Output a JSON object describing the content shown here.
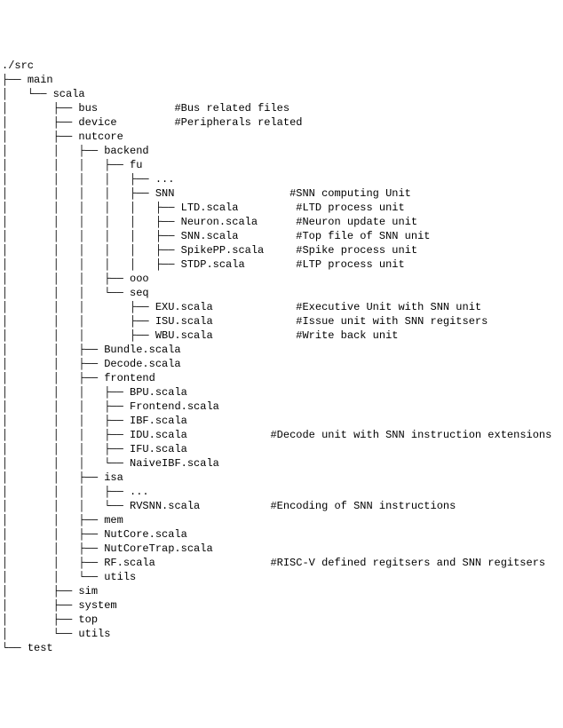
{
  "lines": [
    {
      "prefix": "./",
      "name": "src",
      "comment": ""
    },
    {
      "prefix": "├── ",
      "name": "main",
      "comment": ""
    },
    {
      "prefix": "│   └── ",
      "name": "scala",
      "comment": ""
    },
    {
      "prefix": "│       ├── ",
      "name": "bus",
      "pad": "            ",
      "comment": "#Bus related files"
    },
    {
      "prefix": "│       ├── ",
      "name": "device",
      "pad": "         ",
      "comment": "#Peripherals related"
    },
    {
      "prefix": "│       ├── ",
      "name": "nutcore",
      "comment": ""
    },
    {
      "prefix": "│       │   ├── ",
      "name": "backend",
      "comment": ""
    },
    {
      "prefix": "│       │   │   ├── ",
      "name": "fu",
      "comment": ""
    },
    {
      "prefix": "│       │   │   │   ├── ",
      "name": "...",
      "comment": ""
    },
    {
      "prefix": "│       │   │   │   ├── ",
      "name": "SNN",
      "pad": "                  ",
      "comment": "#SNN computing Unit"
    },
    {
      "prefix": "│       │   │   │   │   ├── ",
      "name": "LTD.scala",
      "pad": "         ",
      "comment": "#LTD process unit"
    },
    {
      "prefix": "│       │   │   │   │   ├── ",
      "name": "Neuron.scala",
      "pad": "      ",
      "comment": "#Neuron update unit"
    },
    {
      "prefix": "│       │   │   │   │   ├── ",
      "name": "SNN.scala",
      "pad": "         ",
      "comment": "#Top file of SNN unit"
    },
    {
      "prefix": "│       │   │   │   │   ├── ",
      "name": "SpikePP.scala",
      "pad": "     ",
      "comment": "#Spike process unit"
    },
    {
      "prefix": "│       │   │   │   │   ├── ",
      "name": "STDP.scala",
      "pad": "        ",
      "comment": "#LTP process unit"
    },
    {
      "prefix": "│       │   │   ├── ",
      "name": "ooo",
      "comment": ""
    },
    {
      "prefix": "│       │   │   └── ",
      "name": "seq",
      "comment": ""
    },
    {
      "prefix": "│       │   │       ├── ",
      "name": "EXU.scala",
      "pad": "             ",
      "comment": "#Executive Unit with SNN unit"
    },
    {
      "prefix": "│       │   │       ├── ",
      "name": "ISU.scala",
      "pad": "             ",
      "comment": "#Issue unit with SNN regitsers"
    },
    {
      "prefix": "│       │   │       ├── ",
      "name": "WBU.scala",
      "pad": "             ",
      "comment": "#Write back unit"
    },
    {
      "prefix": "│       │   ├── ",
      "name": "Bundle.scala",
      "comment": ""
    },
    {
      "prefix": "│       │   ├── ",
      "name": "Decode.scala",
      "comment": ""
    },
    {
      "prefix": "│       │   ├── ",
      "name": "frontend",
      "comment": ""
    },
    {
      "prefix": "│       │   │   ├── ",
      "name": "BPU.scala",
      "comment": ""
    },
    {
      "prefix": "│       │   │   ├── ",
      "name": "Frontend.scala",
      "comment": ""
    },
    {
      "prefix": "│       │   │   ├── ",
      "name": "IBF.scala",
      "comment": ""
    },
    {
      "prefix": "│       │   │   ├── ",
      "name": "IDU.scala",
      "pad": "             ",
      "comment": "#Decode unit with SNN instruction extensions"
    },
    {
      "prefix": "│       │   │   ├── ",
      "name": "IFU.scala",
      "comment": ""
    },
    {
      "prefix": "│       │   │   └── ",
      "name": "NaiveIBF.scala",
      "comment": ""
    },
    {
      "prefix": "│       │   ├── ",
      "name": "isa",
      "comment": ""
    },
    {
      "prefix": "│       │   │   ├── ",
      "name": "...",
      "comment": ""
    },
    {
      "prefix": "│       │   │   └── ",
      "name": "RVSNN.scala",
      "pad": "           ",
      "comment": "#Encoding of SNN instructions"
    },
    {
      "prefix": "│       │   ├── ",
      "name": "mem",
      "comment": ""
    },
    {
      "prefix": "│       │   ├── ",
      "name": "NutCore.scala",
      "comment": ""
    },
    {
      "prefix": "│       │   ├── ",
      "name": "NutCoreTrap.scala",
      "comment": ""
    },
    {
      "prefix": "│       │   ├── ",
      "name": "RF.scala",
      "pad": "                  ",
      "comment": "#RISC-V defined regitsers and SNN regitsers"
    },
    {
      "prefix": "│       │   └── ",
      "name": "utils",
      "comment": ""
    },
    {
      "prefix": "│       ├── ",
      "name": "sim",
      "comment": ""
    },
    {
      "prefix": "│       ├── ",
      "name": "system",
      "comment": ""
    },
    {
      "prefix": "│       ├── ",
      "name": "top",
      "comment": ""
    },
    {
      "prefix": "│       └── ",
      "name": "utils",
      "comment": ""
    },
    {
      "prefix": "└── ",
      "name": "test",
      "comment": ""
    }
  ]
}
